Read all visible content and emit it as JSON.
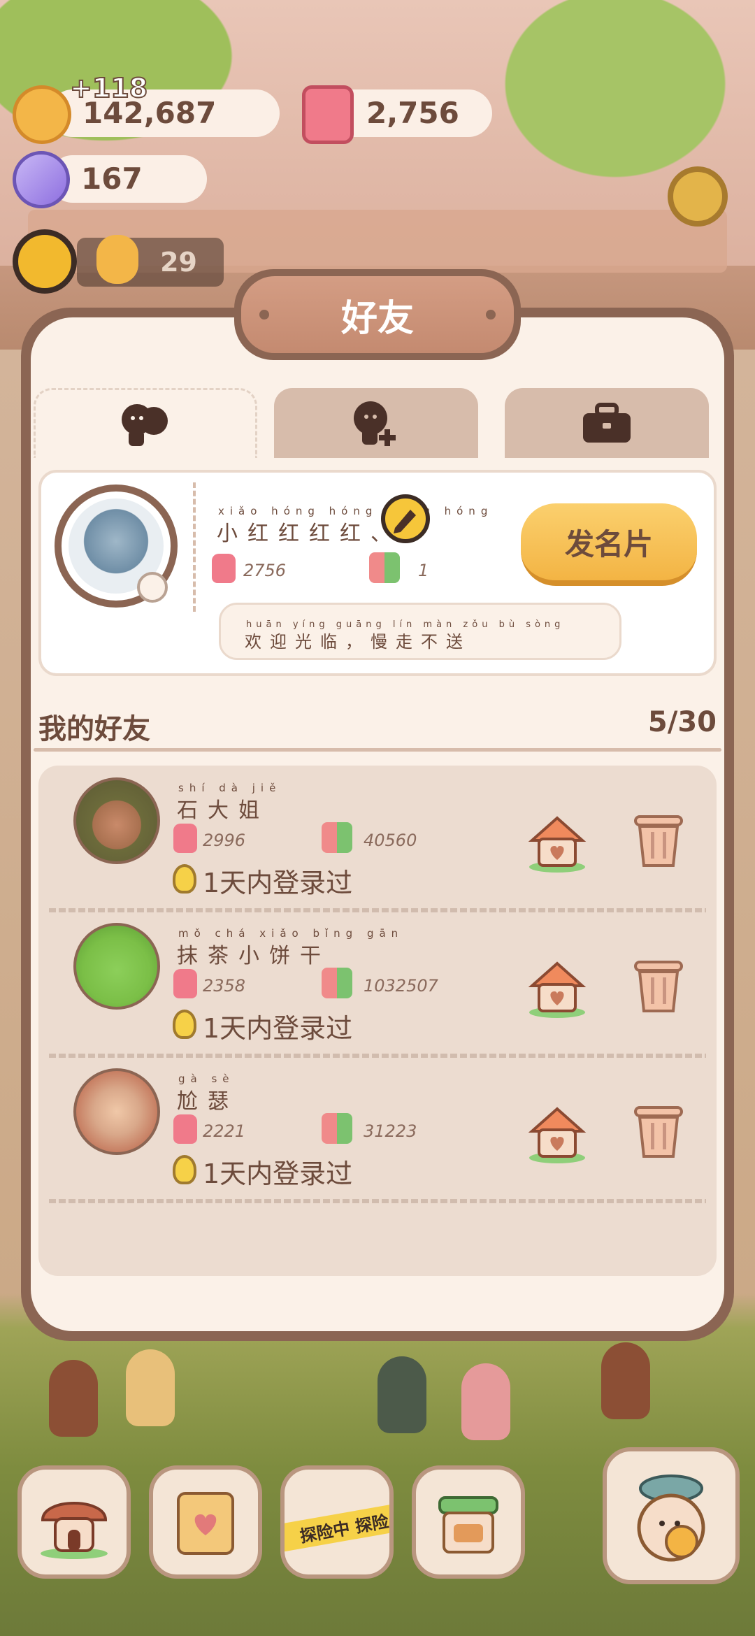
{
  "hud": {
    "coins": "142,687",
    "coins_gain": "+118",
    "candles": "2,756",
    "gems": "167",
    "level_count": "29"
  },
  "panel": {
    "title": "好友",
    "tabs": [
      {
        "name": "friends",
        "icon": "friends-icon"
      },
      {
        "name": "add-friend",
        "icon": "add-friend-icon"
      },
      {
        "name": "bag",
        "icon": "briefcase-icon"
      }
    ]
  },
  "profile": {
    "name_pinyin": "xiǎo hóng hóng hóng hóng",
    "name": "小红红红红、",
    "candles": "2756",
    "gifts": "1",
    "bio_pinyin": "huān yíng guāng lín   màn zǒu bù sòng",
    "bio": "欢迎光临，慢走不送",
    "send_card_label": "发名片"
  },
  "friends_section": {
    "title": "我的好友",
    "count": "5/30",
    "items": [
      {
        "name_pinyin": "shí  dà  jiě",
        "name": "石大姐",
        "candles": "2996",
        "gifts": "40560",
        "status": "1天内登录过"
      },
      {
        "name_pinyin": "mǒ chá xiǎo bǐng gān",
        "name": "抹茶小饼干",
        "candles": "2358",
        "gifts": "1032507",
        "status": "1天内登录过"
      },
      {
        "name_pinyin": "gà  sè",
        "name": "尬瑟",
        "candles": "2221",
        "gifts": "31223",
        "status": "1天内登录过"
      }
    ]
  },
  "bottom_nav": {
    "expedition_label": "探险中 探险"
  },
  "colors": {
    "panel_border": "#8b6553",
    "panel_bg": "#fbf1e8",
    "button_yellow": "#f3b444",
    "text_brown": "#6d4b3c"
  }
}
